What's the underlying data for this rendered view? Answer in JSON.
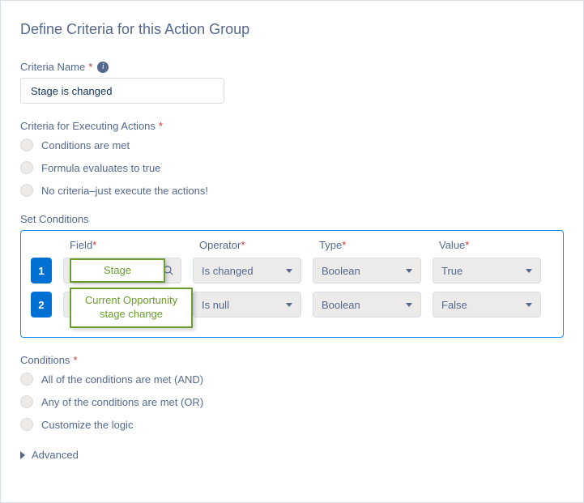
{
  "header": {
    "title": "Define Criteria for this Action Group"
  },
  "criteriaName": {
    "label": "Criteria Name",
    "value": "Stage is changed"
  },
  "executingCriteria": {
    "label": "Criteria for Executing Actions",
    "options": [
      "Conditions are met",
      "Formula evaluates to true",
      "No criteria–just execute the actions!"
    ]
  },
  "setConditions": {
    "label": "Set Conditions",
    "columns": {
      "field": "Field",
      "operator": "Operator",
      "type": "Type",
      "value": "Value"
    },
    "rows": [
      {
        "num": "1",
        "operator": "Is changed",
        "type": "Boolean",
        "value": "True"
      },
      {
        "num": "2",
        "operator": "Is null",
        "type": "Boolean",
        "value": "False"
      }
    ],
    "overlays": {
      "stage": "Stage",
      "currentOpp": "Current Opportunity stage change"
    }
  },
  "conditionsLogic": {
    "label": "Conditions",
    "options": [
      "All of the conditions are met (AND)",
      "Any of the conditions are met (OR)",
      "Customize the logic"
    ]
  },
  "advanced": {
    "label": "Advanced"
  }
}
